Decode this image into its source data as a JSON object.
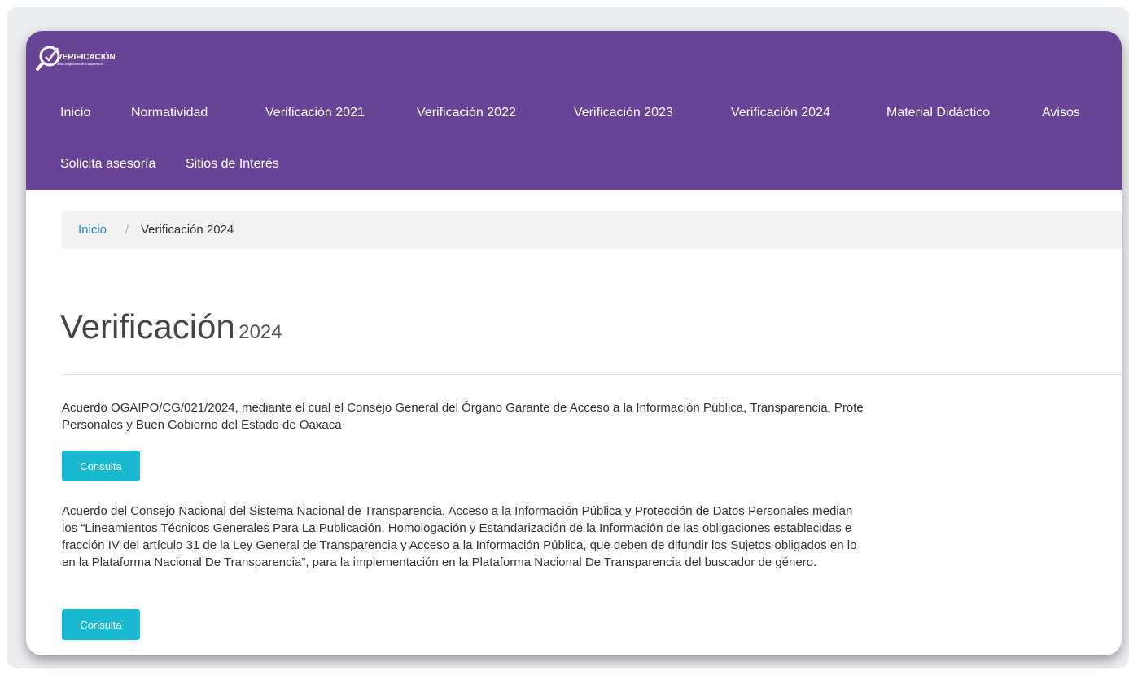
{
  "brand": {
    "title": "VERIFICACIÓN",
    "subtitle": "a las Obligaciones de Transparencia"
  },
  "nav": {
    "items": [
      "Inicio",
      "Normatividad",
      "Verificación 2021",
      "Verificación 2022",
      "Verificación 2023",
      "Verificación 2024",
      "Material Didáctico",
      "Avisos",
      "Solicita asesoría",
      "Sitios de Interés"
    ]
  },
  "breadcrumb": {
    "home": "Inicio",
    "separator": "/",
    "current": "Verificación 2024"
  },
  "page": {
    "title": "Verificación",
    "title_small": "2024"
  },
  "entries": [
    {
      "lines": [
        "Acuerdo OGAIPO/CG/021/2024, mediante el cual el Consejo General del Órgano Garante de Acceso a la Información Pública, Transparencia, Prote",
        "Personales y Buen Gobierno del Estado de Oaxaca"
      ],
      "button": "Consulta"
    },
    {
      "lines": [
        "Acuerdo del Consejo Nacional del Sistema Nacional de Transparencia, Acceso a la Información Pública y Protección de Datos Personales median",
        "los “Lineamientos Técnicos Generales Para La Publicación, Homologación y Estandarización de la Información de las obligaciones establecidas e",
        "fracción IV del artículo 31 de la Ley General de Transparencia y Acceso a la Información Pública, que deben de difundir los Sujetos obligados en lo",
        "en la Plataforma Nacional De Transparencia”, para la implementación en la Plataforma Nacional De Transparencia del buscador de género."
      ],
      "button": "Consulta"
    }
  ],
  "colors": {
    "navbar": "#674496",
    "button": "#18b9d1",
    "link": "#1c87c9"
  }
}
